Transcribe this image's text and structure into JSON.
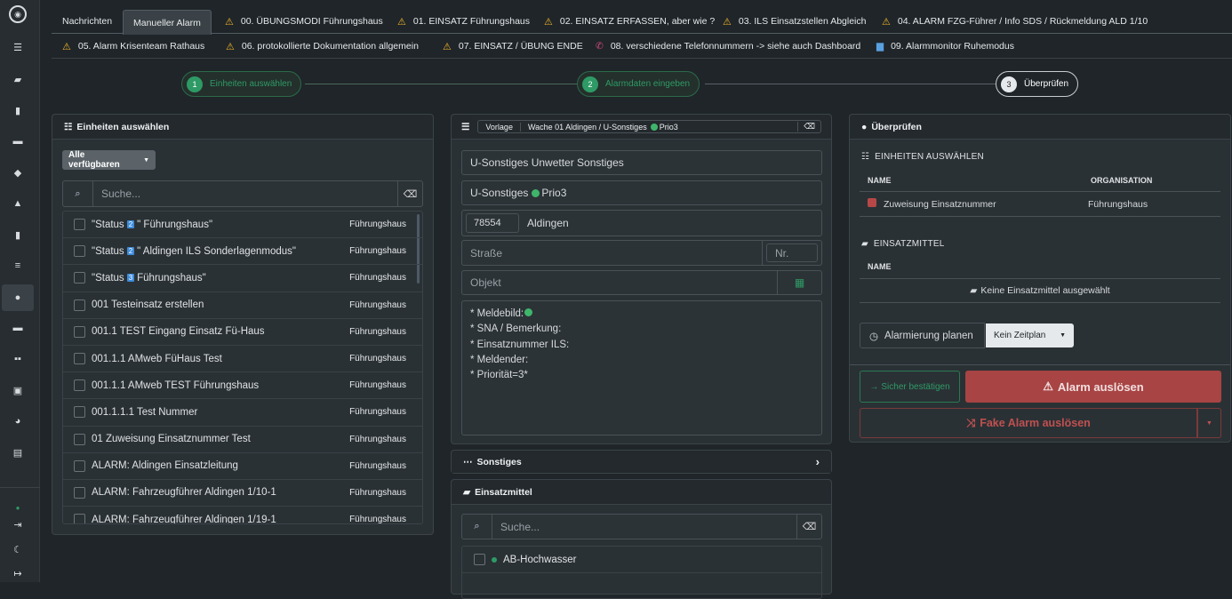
{
  "tabs": {
    "row1": [
      {
        "label": "Nachrichten",
        "warn": false
      },
      {
        "label": "Manueller Alarm",
        "warn": false
      },
      {
        "label": "00. ÜBUNGSMODI Führungshaus",
        "warn": true
      },
      {
        "label": "01. EINSATZ Führungshaus",
        "warn": true
      },
      {
        "label": "02. EINSATZ ERFASSEN, aber wie ?",
        "warn": true
      },
      {
        "label": "03. ILS Einsatzstellen Abgleich",
        "warn": true
      },
      {
        "label": "04. ALARM FZG-Führer / Info SDS / Rückmeldung ALD 1/10",
        "warn": true
      }
    ],
    "row2": [
      {
        "label": "05. Alarm Krisenteam Rathaus",
        "warn": true
      },
      {
        "label": "06. protokollierte Dokumentation allgemein",
        "warn": true
      },
      {
        "label": "07. EINSATZ / ÜBUNG ENDE",
        "warn": true
      },
      {
        "label": "08. verschiedene Telefonnummern -> siehe auch Dashboard",
        "icon": "phone-icon"
      },
      {
        "label": "09. Alarmmonitor Ruhemodus",
        "icon": "monitor-icon"
      }
    ]
  },
  "steps": [
    {
      "num": "1",
      "label": "Einheiten auswählen"
    },
    {
      "num": "2",
      "label": "Alarmdaten eingeben"
    },
    {
      "num": "3",
      "label": "Überprüfen"
    }
  ],
  "units_panel": {
    "title": "Einheiten auswählen",
    "filter_label": "Alle verfügbaren",
    "search_placeholder": "Suche...",
    "rows": [
      {
        "pre": "\"Status",
        "badge": "2",
        "post": "\" Führungshaus\"",
        "org": "Führungshaus"
      },
      {
        "pre": "\"Status",
        "badge": "2",
        "post": "\" Aldingen ILS Sonderlagenmodus\"",
        "org": "Führungshaus"
      },
      {
        "pre": "\"Status",
        "badge": "3",
        "post": "Führungshaus\"",
        "org": "Führungshaus"
      },
      {
        "pre": "001 Testeinsatz erstellen",
        "badge": "",
        "post": "",
        "org": "Führungshaus"
      },
      {
        "pre": "001.1 TEST Eingang Einsatz Fü-Haus",
        "badge": "",
        "post": "",
        "org": "Führungshaus"
      },
      {
        "pre": "001.1.1 AMweb FüHaus Test",
        "badge": "",
        "post": "",
        "org": "Führungshaus"
      },
      {
        "pre": "001.1.1 AMweb TEST Führungshaus",
        "badge": "",
        "post": "",
        "org": "Führungshaus"
      },
      {
        "pre": "001.1.1.1 Test Nummer",
        "badge": "",
        "post": "",
        "org": "Führungshaus"
      },
      {
        "pre": "01 Zuweisung Einsatznummer Test",
        "badge": "",
        "post": "",
        "org": "Führungshaus"
      },
      {
        "pre": "ALARM: Aldingen Einsatzleitung",
        "badge": "",
        "post": "",
        "org": "Führungshaus"
      },
      {
        "pre": "ALARM: Fahrzeugführer Aldingen 1/10-1",
        "badge": "",
        "post": "",
        "org": "Führungshaus"
      },
      {
        "pre": "ALARM: Fahrzeugführer Aldingen 1/19-1",
        "badge": "",
        "post": "",
        "org": "Führungshaus"
      }
    ]
  },
  "alarm_panel": {
    "template_label": "Vorlage",
    "template_value": "Wache 01 Aldingen / U-Sonstiges",
    "template_prio": "Prio3",
    "keyword": "U-Sonstiges Unwetter Sonstiges",
    "category": "U-Sonstiges",
    "category_prio": "Prio3",
    "zip": "78554",
    "city": "Aldingen",
    "street_placeholder": "Straße",
    "nr_placeholder": "Nr.",
    "object_placeholder": "Objekt",
    "message_lines": [
      "* Meldebild:",
      "* SNA / Bemerkung:",
      "* Einsatznummer ILS:",
      "* Meldender:",
      "* Priorität=3*"
    ],
    "sonstiges_label": "Sonstiges",
    "einsatzmittel_label": "Einsatzmittel",
    "em_search_placeholder": "Suche...",
    "em_first": "AB-Hochwasser"
  },
  "review_panel": {
    "title": "Überprüfen",
    "units_heading": "EINHEITEN AUSWÄHLEN",
    "col_name": "NAME",
    "col_org": "ORGANISATION",
    "unit_name": "Zuweisung Einsatznummer",
    "unit_org": "Führungshaus",
    "em_heading": "EINSATZMITTEL",
    "em_col_name": "NAME",
    "em_empty": "Keine Einsatzmittel ausgewählt",
    "plan_label": "Alarmierung planen",
    "plan_value": "Kein Zeitplan",
    "confirm_label": "Sicher bestätigen",
    "alarm_label": "Alarm auslösen",
    "fake_label": "Fake Alarm auslösen"
  },
  "colors": {
    "accent_green": "#2e9a65",
    "alarm_red": "#c04a4a",
    "warn": "#f0b429"
  }
}
